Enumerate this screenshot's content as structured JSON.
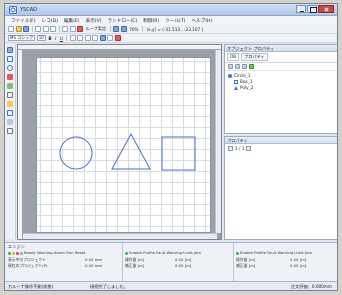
{
  "window": {
    "title": "YSCAD"
  },
  "menu": [
    "ファイル(F)",
    "レコ(D)",
    "編集(E)",
    "表示(V)",
    "ランドロー(C)",
    "制御(R)",
    "ツール(T)",
    "ヘルプ(H)"
  ],
  "toolbar1": {
    "zoom": "70%",
    "coords": "(x,y) = (-31.513 , -23.107 )",
    "snap_label": "ループ実定"
  },
  "toolbar2": {
    "font_combo": "MS ゴシック",
    "size_combo": "10",
    "style_buttons": [
      "B",
      "I",
      "U"
    ]
  },
  "object_panel": {
    "title": "オブジェクト プロパティ",
    "tabs": [
      "OB",
      "プロパティ"
    ],
    "tree": [
      {
        "label": "Circle_1",
        "icon": "circle-icon"
      },
      {
        "label": "Box_1",
        "icon": "box-icon"
      },
      {
        "label": "Poly_2",
        "icon": "triangle-icon"
      }
    ]
  },
  "property_panel": {
    "title": "プロパティ",
    "page": "1 / 1"
  },
  "bottom": {
    "title": "エンジン",
    "status_row": "Ready Warning Alarm Run Reset",
    "col2_header": "Enable Profile Fault Warning Limit Jam",
    "rows": [
      {
        "label": "表示中のプロジェクト",
        "v1": "0.00",
        "v2": "mm"
      },
      {
        "label": "現在のプロジェクト(P)",
        "v1": "0.00",
        "v2": "mm"
      }
    ],
    "col2_rows": [
      {
        "label": "操作量 [m]",
        "v1": "0.00",
        "v2": "[m]"
      },
      {
        "label": "補正量 [m]",
        "v1": "0.00",
        "v2": "[m]"
      }
    ],
    "col3_rows": [
      {
        "label": "操作量 [m]",
        "v1": "0.00",
        "v2": "[m]"
      },
      {
        "label": "補正量 [m]",
        "v1": "0.00",
        "v2": "[m]"
      }
    ]
  },
  "status": {
    "left": "カルーナ操作不能(状態)",
    "middle": "接続完了しました。",
    "right": "注文評価：0.000mm"
  },
  "colors": {
    "accent": "#3e74c9",
    "shape_stroke": "#4a6fc8"
  }
}
